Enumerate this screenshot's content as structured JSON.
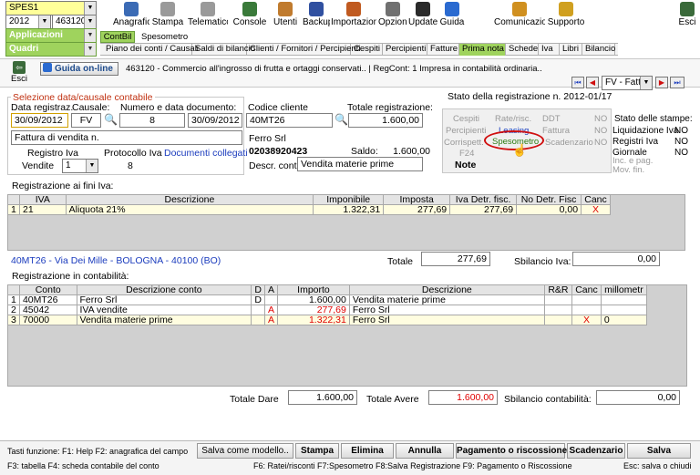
{
  "top_selects": {
    "company": "SPES1",
    "applications": "Applicazioni",
    "year": "2012",
    "code": "463120 -",
    "quadri": "Quadri"
  },
  "toolbar": [
    {
      "id": "anagrafica",
      "label": "Anagrafica",
      "icon": "person-card-icon",
      "color": "#3b6bb5"
    },
    {
      "id": "stampa",
      "label": "Stampa",
      "icon": "printer-icon",
      "color": "#9a9a9a"
    },
    {
      "id": "telematico",
      "label": "Telematico",
      "icon": "network-icon",
      "color": "#9a9a9a"
    },
    {
      "id": "console",
      "label": "Console T.",
      "icon": "console-icon",
      "color": "#3a7a3a"
    },
    {
      "id": "utenti",
      "label": "Utenti",
      "icon": "users-icon",
      "color": "#c07b2e"
    },
    {
      "id": "backup",
      "label": "Backup",
      "icon": "floppy-icon",
      "color": "#3050a0"
    },
    {
      "id": "importazioni",
      "label": "Importazioni",
      "icon": "import-icon",
      "color": "#c05a20"
    },
    {
      "id": "opzioni",
      "label": "Opzioni",
      "icon": "wrench-icon",
      "color": "#707070"
    },
    {
      "id": "update",
      "label": "Update",
      "icon": "update-icon",
      "color": "#2a2a2a"
    },
    {
      "id": "guida",
      "label": "Guida",
      "icon": "help-icon",
      "color": "#2a6ad0"
    },
    {
      "id": "comunicazioni",
      "label": "Comunicazioni",
      "icon": "message-icon",
      "color": "#d09020"
    },
    {
      "id": "supporto",
      "label": "Supporto",
      "icon": "support-icon",
      "color": "#d0a020"
    },
    {
      "id": "esci",
      "label": "Esci",
      "icon": "exit-door-icon",
      "color": "#3a6a3a"
    }
  ],
  "subtabs": {
    "contbil": "ContBil",
    "spesometro": "Spesometro"
  },
  "tabs": [
    "Piano dei conti / Causali",
    "Saldi di bilancio",
    "Clienti / Fornitori / Percipienti",
    "Cespiti",
    "Percipienti",
    "Fatture",
    "Prima nota",
    "Schede",
    "Iva",
    "Libri",
    "Bilancio"
  ],
  "active_tab": "Prima nota",
  "infobar": {
    "esci": "Esci",
    "guida": "Guida on-line",
    "text": "463120 - Commercio all'ingrosso di frutta e ortaggi conservati.. | RegCont: 1 Impresa  in contabilità ordinaria.."
  },
  "nav": {
    "doc_type": "FV - Fattu"
  },
  "selection": {
    "title": "Selezione data/causale contabile",
    "data_label": "Data registraz.",
    "causale_label": "Causale:",
    "numero_label": "Numero e data documento:",
    "data_value": "30/09/2012",
    "causale_value": "FV",
    "numero_value": "8",
    "data_doc_value": "30/09/2012",
    "description": "Fattura di vendita n.",
    "registro_label": "Registro Iva",
    "protocollo_label": "Protocollo Iva",
    "documenti_link": "Documenti collegati",
    "vendite_label": "Vendite",
    "registro_value": "1",
    "protocollo_value": "8"
  },
  "client": {
    "code_label": "Codice cliente",
    "code_value": "40MT26",
    "totale_label": "Totale registrazione:",
    "totale_value": "1.600,00",
    "name": "Ferro Srl",
    "phone": "02038920423",
    "saldo_label": "Saldo:",
    "saldo_value": "1.600,00",
    "descr_label": "Descr. conto",
    "descr_value": "Vendita materie prime"
  },
  "status": {
    "title": "Stato della registrazione n. 2012-01/17",
    "row1": [
      "Cespiti",
      "Rate/risc.",
      "DDT",
      "NO"
    ],
    "row2": [
      "Percipienti",
      "Leasing",
      "Fattura",
      "NO"
    ],
    "row3": [
      "Corrispett.",
      "Spesometro",
      "Scadenzario",
      "NO"
    ],
    "row4": [
      "F24"
    ],
    "note": "Note",
    "stampe_title": "Stato delle stampe:",
    "stampe": [
      {
        "label": "Liquidazione Iva",
        "value": "NO"
      },
      {
        "label": "Registri Iva",
        "value": "NO"
      },
      {
        "label": "Giornale",
        "value": "NO"
      }
    ],
    "inc_pag": "Inc. e pag.",
    "mov_fin": "Mov. fin."
  },
  "iva": {
    "title": "Registrazione ai fini Iva:",
    "headers": [
      "",
      "IVA",
      "Descrizione",
      "Imponibile",
      "Imposta",
      "Iva Detr. fisc.",
      "No Detr. Fisc",
      "Canc"
    ],
    "rows": [
      {
        "n": "1",
        "iva": "21",
        "descr": "Aliquota 21%",
        "imponibile": "1.322,31",
        "imposta": "277,69",
        "detr": "277,69",
        "nodetr": "0,00",
        "canc": "X"
      }
    ],
    "address": "40MT26 - Via Dei Mille - BOLOGNA - 40100 (BO)",
    "totale_label": "Totale",
    "totale_value": "277,69",
    "sbilancio_label": "Sbilancio Iva:",
    "sbilancio_value": "0,00"
  },
  "contab": {
    "title": "Registrazione in contabilità:",
    "headers": [
      "",
      "Conto",
      "Descrizione conto",
      "D",
      "A",
      "Importo",
      "Descrizione",
      "R&R",
      "Canc",
      "millometr"
    ],
    "rows": [
      {
        "n": "1",
        "conto": "40MT26",
        "descr": "Ferro Srl",
        "d": "D",
        "a": "",
        "importo": "1.600,00",
        "descr2": "Vendita materie prime",
        "rr": "",
        "canc": "",
        "mill": ""
      },
      {
        "n": "2",
        "conto": "45042",
        "descr": "IVA vendite",
        "d": "",
        "a": "A",
        "importo": "277,69",
        "descr2": "Ferro Srl",
        "rr": "",
        "canc": "",
        "mill": ""
      },
      {
        "n": "3",
        "conto": "70000",
        "descr": "Vendita materie prime",
        "d": "",
        "a": "A",
        "importo": "1.322,31",
        "descr2": "Ferro Srl",
        "rr": "",
        "canc": "X",
        "mill": "0"
      }
    ],
    "dare_label": "Totale Dare",
    "dare_value": "1.600,00",
    "avere_label": "Totale Avere",
    "avere_value": "1.600,00",
    "sbil_label": "Sbilancio contabilità:",
    "sbil_value": "0,00"
  },
  "footer": {
    "keys1": "Tasti funzione: F1: Help  F2: anagrafica del campo",
    "keys2": "F3: tabella   F4: scheda contabile del conto",
    "keys3": "F6: Ratei/risconti   F7:Spesometro   F8:Salva Registrazione   F9: Pagamento o Riscossione",
    "keys4": "Esc: salva o chiudi",
    "buttons": {
      "salva_modello": "Salva come modello..",
      "stampa": "Stampa",
      "elimina": "Elimina",
      "annulla": "Annulla",
      "pagamento": "Pagamento o riscossione",
      "scadenzario": "Scadenzario",
      "salva": "Salva"
    }
  }
}
